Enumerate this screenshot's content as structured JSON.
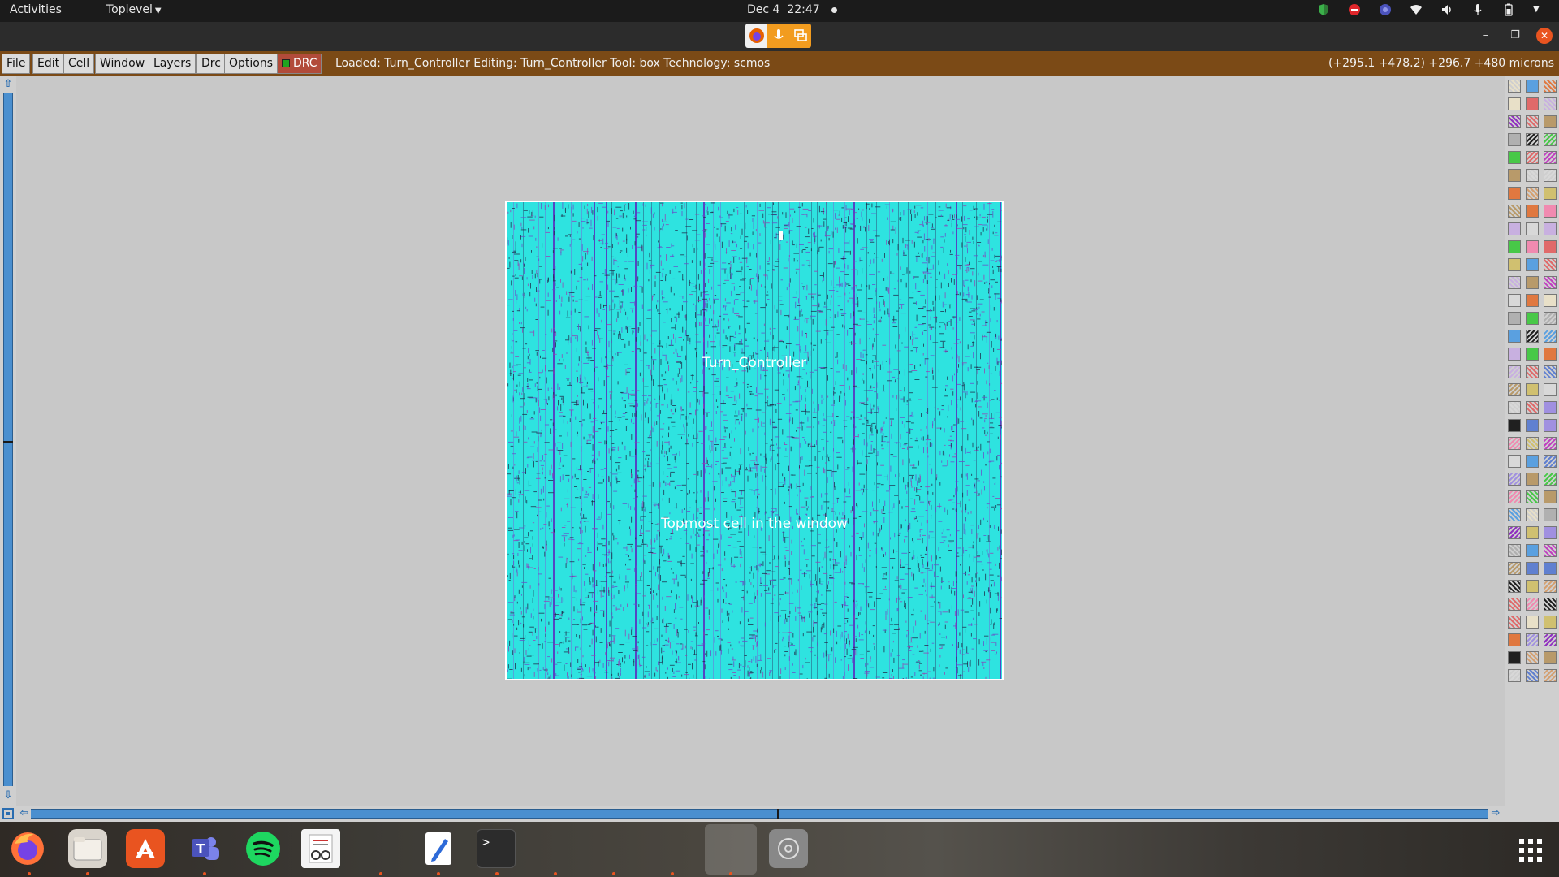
{
  "topbar": {
    "activities": "Activities",
    "app_menu": "Toplevel",
    "date": "Dec 4",
    "time": "22:47"
  },
  "menu": {
    "items": [
      "File",
      "Edit",
      "Cell",
      "Window",
      "Layers",
      "Drc",
      "Options"
    ],
    "drc_label": "DRC",
    "status": "Loaded: Turn_Controller Editing: Turn_Controller Tool: box  Technology: scmos",
    "coords": "(+295.1 +478.2) +296.7 +480 microns"
  },
  "cell": {
    "name": "Turn_Controller",
    "caption": "Topmost cell in the window",
    "fill_color": "#2ee3e0"
  },
  "colors": {
    "menubar": "#7b4a16",
    "canvas": "#c8c8c8",
    "scrollbar": "#4a8fcf",
    "drc_button": "#b24b3a"
  },
  "dock": {
    "apps": [
      "firefox-icon",
      "files-icon",
      "software-center-icon",
      "teams-icon",
      "spotify-icon",
      "document-viewer-icon",
      "text-editor-icon",
      "terminal-icon",
      "magic-window-icon",
      "disc-icon"
    ]
  }
}
